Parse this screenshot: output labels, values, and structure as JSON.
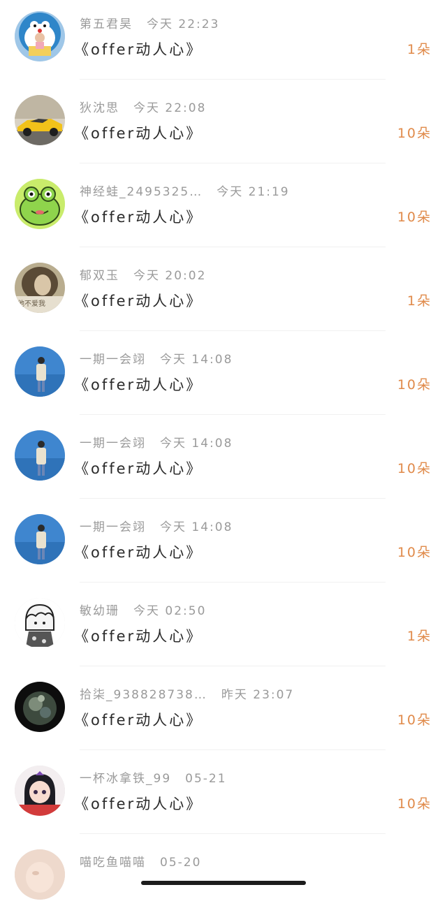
{
  "rows": [
    {
      "name": "第五君昊",
      "time": "今天 22:23",
      "title": "《offer动人心》",
      "count": "1朵",
      "avatar": "doraemon-girl"
    },
    {
      "name": "狄沈思",
      "time": "今天 22:08",
      "title": "《offer动人心》",
      "count": "10朵",
      "avatar": "yellow-car"
    },
    {
      "name": "神经蛙_2495325…",
      "time": "今天 21:19",
      "title": "《offer动人心》",
      "count": "10朵",
      "avatar": "green-frog"
    },
    {
      "name": "郁双玉",
      "time": "今天 20:02",
      "title": "《offer动人心》",
      "count": "1朵",
      "avatar": "woman-portrait",
      "avatar_caption": "他不爱我"
    },
    {
      "name": "一期一会翊",
      "time": "今天 14:08",
      "title": "《offer动人心》",
      "count": "10朵",
      "avatar": "sea-person"
    },
    {
      "name": "一期一会翊",
      "time": "今天 14:08",
      "title": "《offer动人心》",
      "count": "10朵",
      "avatar": "sea-person"
    },
    {
      "name": "一期一会翊",
      "time": "今天 14:08",
      "title": "《offer动人心》",
      "count": "10朵",
      "avatar": "sea-person"
    },
    {
      "name": "敏幼珊",
      "time": "今天 02:50",
      "title": "《offer动人心》",
      "count": "1朵",
      "avatar": "sketch-girl"
    },
    {
      "name": "拾柒_938828738…",
      "time": "昨天 23:07",
      "title": "《offer动人心》",
      "count": "10朵",
      "avatar": "dark-abstract"
    },
    {
      "name": "一杯冰拿铁_99",
      "time": "05-21",
      "title": "《offer动人心》",
      "count": "10朵",
      "avatar": "anime-girl"
    },
    {
      "name": "喵吃鱼喵喵",
      "time": "05-20",
      "title": "",
      "count": "",
      "avatar": "pale-photo"
    }
  ],
  "colors": {
    "count": "#e08a4a",
    "meta": "#9a9a9a",
    "title": "#2a2a2a"
  }
}
